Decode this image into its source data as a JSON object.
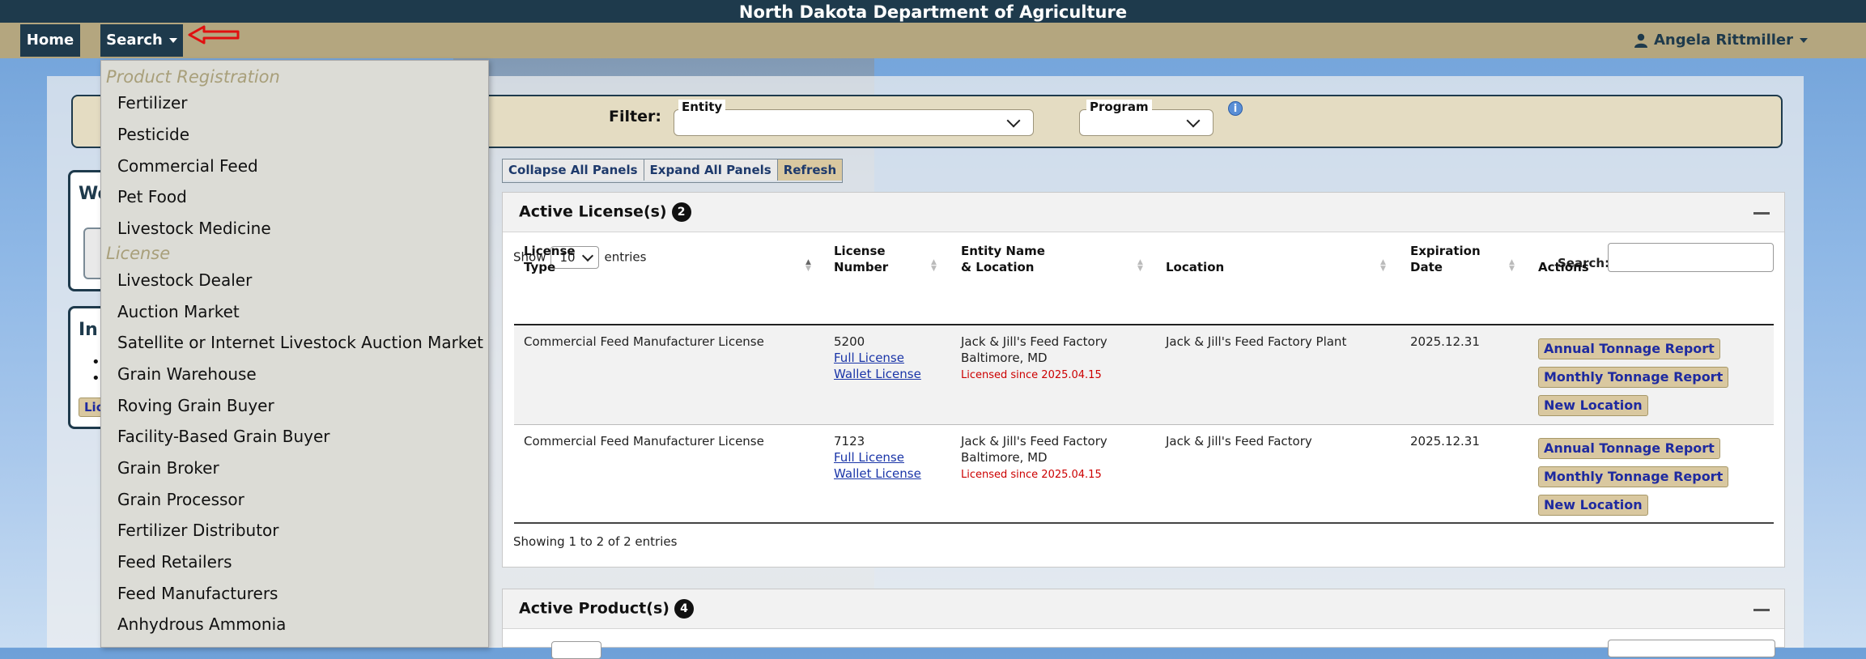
{
  "app": {
    "title": "North Dakota Department of Agriculture"
  },
  "nav": {
    "home_label": "Home",
    "search_label": "Search",
    "user_name": "Angela Rittmiller"
  },
  "filter": {
    "label": "Filter:",
    "entity_legend": "Entity",
    "program_legend": "Program",
    "info_icon": "i"
  },
  "side": {
    "card1_heading": "We",
    "card2_heading": "In",
    "bullet": "•",
    "button_label": "Lic"
  },
  "panel_tools": {
    "collapse": "Collapse All Panels",
    "expand": "Expand All Panels",
    "refresh": "Refresh"
  },
  "licenses": {
    "title": "Active License(s)",
    "count": "2",
    "show_label": "Show",
    "page_size": "10",
    "entries_label": "entries",
    "search_label": "Search:",
    "columns": {
      "type_1": "License",
      "type_2": "Type",
      "number_1": "License",
      "number_2": "Number",
      "entity_1": "Entity Name",
      "entity_2": "& Location",
      "location": "Location",
      "exp_1": "Expiration",
      "exp_2": "Date",
      "actions": "Actions"
    },
    "rows": [
      {
        "type": "Commercial Feed Manufacturer License",
        "number": "5200",
        "full_link": "Full License",
        "wallet_link": "Wallet License",
        "entity": "Jack & Jill's Feed Factory",
        "city": "Baltimore, MD",
        "since": "Licensed since 2025.04.15",
        "location": "Jack & Jill's Feed Factory Plant",
        "expiration": "2025.12.31",
        "actions": [
          "Annual Tonnage Report",
          "Monthly Tonnage Report",
          "New Location"
        ]
      },
      {
        "type": "Commercial Feed Manufacturer License",
        "number": "7123",
        "full_link": "Full License",
        "wallet_link": "Wallet License",
        "entity": "Jack & Jill's Feed Factory",
        "city": "Baltimore, MD",
        "since": "Licensed since 2025.04.15",
        "location": "Jack & Jill's Feed Factory",
        "expiration": "2025.12.31",
        "actions": [
          "Annual Tonnage Report",
          "Monthly Tonnage Report",
          "New Location"
        ]
      }
    ],
    "footer": "Showing 1 to 2 of 2 entries"
  },
  "products": {
    "title": "Active Product(s)",
    "count": "4"
  },
  "dropdown": {
    "header_product": "Product Registration",
    "product_items": [
      "Fertilizer",
      "Pesticide",
      "Commercial Feed",
      "Pet Food",
      "Livestock Medicine"
    ],
    "header_license": "License",
    "license_items": [
      "Livestock Dealer",
      "Auction Market",
      "Satellite or Internet Livestock Auction Market",
      "Grain Warehouse",
      "Roving Grain Buyer",
      "Facility-Based Grain Buyer",
      "Grain Broker",
      "Grain Processor",
      "Fertilizer Distributor",
      "Feed Retailers",
      "Feed Manufacturers",
      "Anhydrous Ammonia"
    ]
  },
  "colors": {
    "navy": "#1e3a4c",
    "tan": "#b4a67f",
    "button_tan": "#d9c8a0",
    "link_blue": "#1a35a8",
    "annotation_red": "#e01010"
  }
}
